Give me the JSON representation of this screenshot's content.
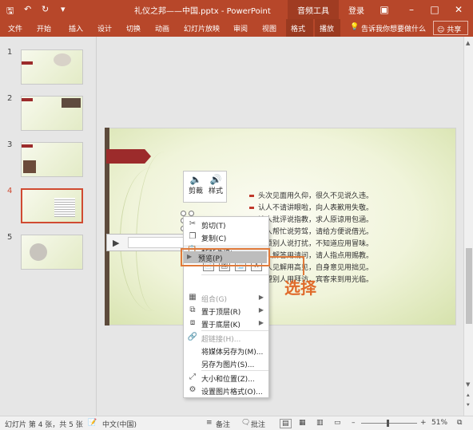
{
  "titlebar": {
    "title": "礼仪之邦——中国.pptx - PowerPoint",
    "tools_label": "音频工具",
    "signin": "登录",
    "save_icon": "save-icon",
    "undo_icon": "undo-icon",
    "redo_icon": "redo-icon"
  },
  "menu": {
    "items": [
      "文件",
      "开始",
      "插入",
      "设计",
      "切换",
      "动画",
      "幻灯片放映",
      "审阅",
      "视图",
      "格式",
      "播放"
    ],
    "tell_me": "告诉我你想要做什么",
    "share": "共享"
  },
  "thumbnails": [
    {
      "num": "1",
      "selected": false
    },
    {
      "num": "2",
      "selected": false
    },
    {
      "num": "3",
      "selected": false
    },
    {
      "num": "4",
      "selected": true
    },
    {
      "num": "5",
      "selected": false
    }
  ],
  "slide": {
    "bullets": [
      "头次见面用久仰，很久不见说久违。",
      "认人不请讲眼啦，向人表歉用失敬。",
      "请人批评说指教，求人原谅用包涵。",
      "请人帮忙说劳驾，请给方便说借光。",
      "麻烦别人说打扰，不知道应用冒味。",
      "求人解答用请问，请人指点用赐教。",
      "赞人见解用高见，自身意见用拙见。",
      "看望别人用拜访，宾客来到用光临。"
    ]
  },
  "mini_toolbar": {
    "trim": "剪裁",
    "style": "样式"
  },
  "context_menu": {
    "cut": "剪切(T)",
    "copy": "复制(C)",
    "paste_options": "粘贴选项:",
    "preview": "预览(P)",
    "group": "组合(G)",
    "bring_front": "置于顶层(R)",
    "send_back": "置于底层(K)",
    "link": "超链接(H)...",
    "save_media": "将媒体另存为(M)...",
    "save_picture": "另存为图片(S)...",
    "size_position": "大小和位置(Z)...",
    "format_picture": "设置图片格式(O)..."
  },
  "callout": "选择",
  "status": {
    "slide_info": "幻灯片 第 4 张，共 5 张",
    "language": "中文(中国)",
    "notes": "备注",
    "comments": "批注",
    "zoom": "51%"
  },
  "colors": {
    "accent": "#b7472a",
    "highlight": "#e07a3a",
    "slide_bar": "#9c2b2b"
  }
}
